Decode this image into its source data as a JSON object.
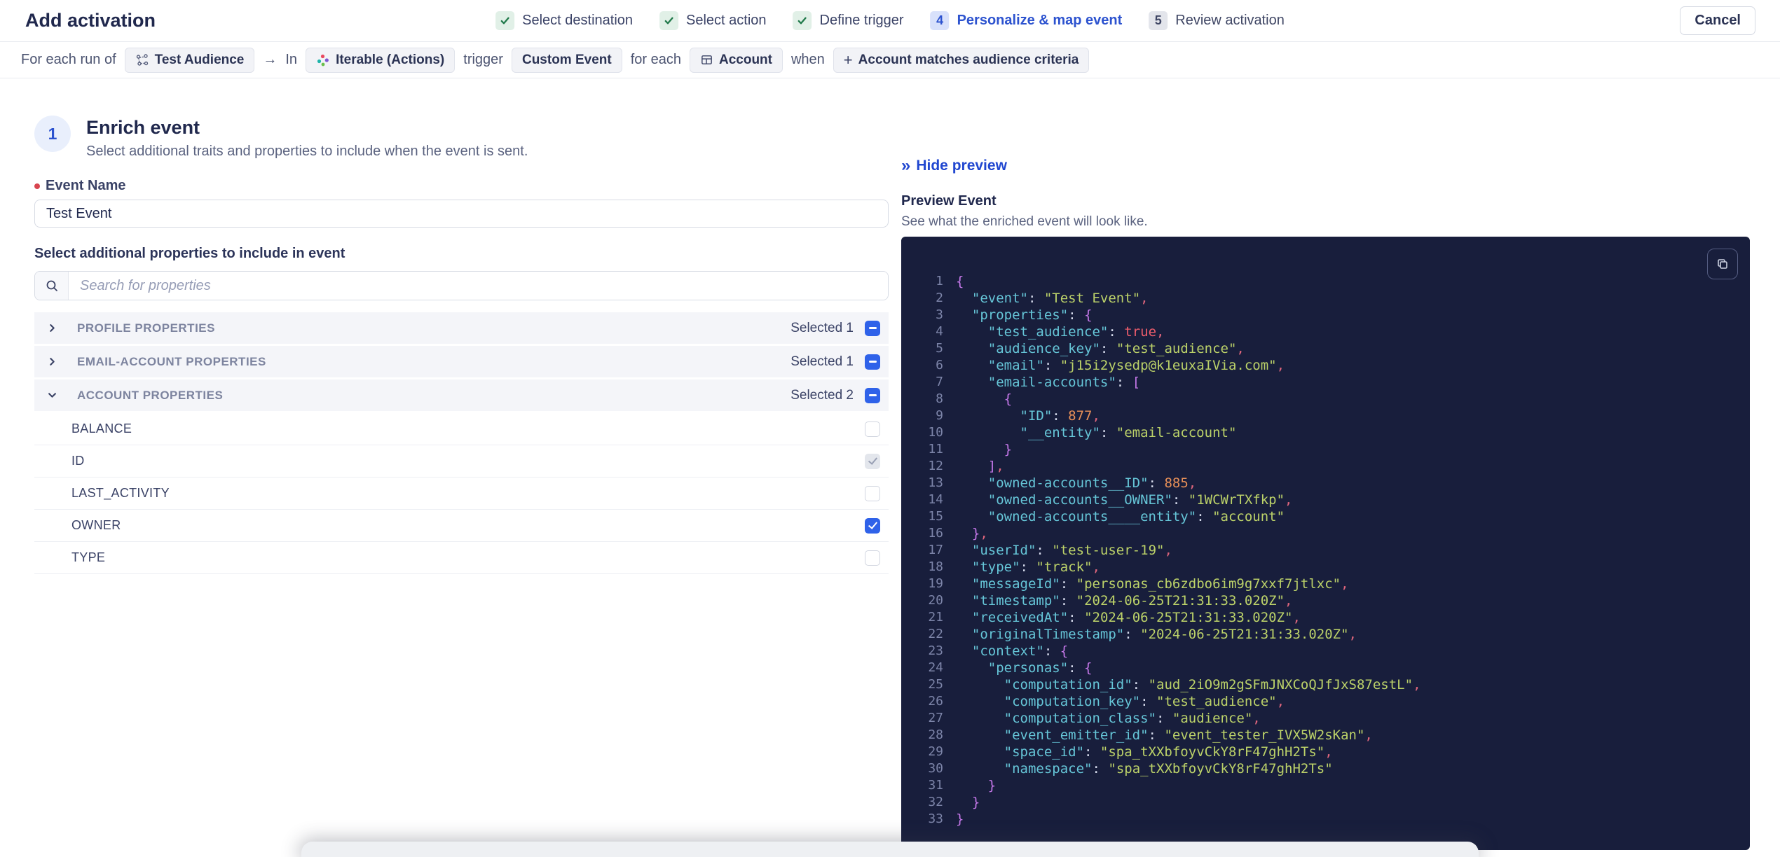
{
  "header": {
    "title": "Add activation",
    "cancel_label": "Cancel",
    "steps": [
      {
        "label": "Select destination",
        "state": "done"
      },
      {
        "label": "Select action",
        "state": "done"
      },
      {
        "label": "Define trigger",
        "state": "done"
      },
      {
        "label": "Personalize & map event",
        "state": "active",
        "number": "4"
      },
      {
        "label": "Review activation",
        "state": "upcoming",
        "number": "5"
      }
    ]
  },
  "context_bar": {
    "segments": [
      {
        "type": "text",
        "text": "For each run of"
      },
      {
        "type": "chip",
        "icon": "audience-icon",
        "label": "Test Audience"
      },
      {
        "type": "text",
        "text": "→"
      },
      {
        "type": "text",
        "text": "In"
      },
      {
        "type": "chip",
        "icon": "iterable-icon",
        "label": "Iterable (Actions)"
      },
      {
        "type": "text",
        "text": "trigger"
      },
      {
        "type": "chip",
        "label": "Custom Event"
      },
      {
        "type": "text",
        "text": "for each"
      },
      {
        "type": "chip",
        "icon": "table-icon",
        "label": "Account"
      },
      {
        "type": "text",
        "text": "when"
      },
      {
        "type": "chip",
        "icon": "plus-icon",
        "label": "Account matches audience criteria"
      }
    ]
  },
  "enrich": {
    "step_number": "1",
    "title": "Enrich event",
    "subtitle": "Select additional traits and properties to include when the event is sent.",
    "event_name_label": "Event Name",
    "event_name_value": "Test Event",
    "properties_label": "Select additional properties to include in event",
    "search_placeholder": "Search for properties",
    "groups": [
      {
        "label": "PROFILE PROPERTIES",
        "selected_text": "Selected 1",
        "expanded": false,
        "items": []
      },
      {
        "label": "EMAIL-ACCOUNT PROPERTIES",
        "selected_text": "Selected 1",
        "expanded": false,
        "items": []
      },
      {
        "label": "ACCOUNT PROPERTIES",
        "selected_text": "Selected 2",
        "expanded": true,
        "items": [
          {
            "label": "BALANCE",
            "checkbox": "unchecked"
          },
          {
            "label": "ID",
            "checkbox": "checked-disabled"
          },
          {
            "label": "LAST_ACTIVITY",
            "checkbox": "unchecked"
          },
          {
            "label": "OWNER",
            "checkbox": "checked"
          },
          {
            "label": "TYPE",
            "checkbox": "unchecked"
          }
        ]
      }
    ]
  },
  "preview": {
    "hide_label": "Hide preview",
    "title": "Preview Event",
    "subtitle": "See what the enriched event will look like.",
    "code_lines": [
      "{",
      "  \"event\": \"Test Event\",",
      "  \"properties\": {",
      "    \"test_audience\": true,",
      "    \"audience_key\": \"test_audience\",",
      "    \"email\": \"j15i2ysedp@k1euxaIVia.com\",",
      "    \"email-accounts\": [",
      "      {",
      "        \"ID\": 877,",
      "        \"__entity\": \"email-account\"",
      "      }",
      "    ],",
      "    \"owned-accounts__ID\": 885,",
      "    \"owned-accounts__OWNER\": \"1WCWrTXfkp\",",
      "    \"owned-accounts____entity\": \"account\"",
      "  },",
      "  \"userId\": \"test-user-19\",",
      "  \"type\": \"track\",",
      "  \"messageId\": \"personas_cb6zdbo6im9g7xxf7jtlxc\",",
      "  \"timestamp\": \"2024-06-25T21:31:33.020Z\",",
      "  \"receivedAt\": \"2024-06-25T21:31:33.020Z\",",
      "  \"originalTimestamp\": \"2024-06-25T21:31:33.020Z\",",
      "  \"context\": {",
      "    \"personas\": {",
      "      \"computation_id\": \"aud_2iO9m2gSFmJNXCoQJfJxS87estL\",",
      "      \"computation_key\": \"test_audience\",",
      "      \"computation_class\": \"audience\",",
      "      \"event_emitter_id\": \"event_tester_IVX5W2sKan\",",
      "      \"space_id\": \"spa_tXXbfoyvCkY8rF47ghH2Ts\",",
      "      \"namespace\": \"spa_tXXbfoyvCkY8rF47ghH2Ts\"",
      "    }",
      "  }",
      "}"
    ]
  },
  "colors": {
    "accent_blue": "#2d53cf",
    "checkbox_blue": "#2f62e9",
    "success_green": "#217a4b",
    "code_bg": "#181e3c",
    "code_key": "#66c6d8",
    "code_string": "#bcd269",
    "code_number": "#e89058",
    "code_boolean": "#ee5d6c",
    "code_brace": "#c678ea",
    "code_line_number": "#7c84a8"
  }
}
